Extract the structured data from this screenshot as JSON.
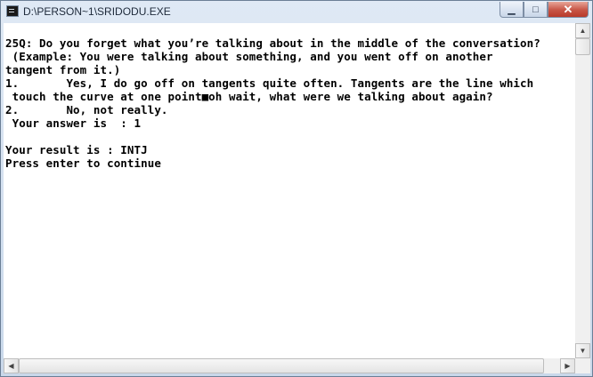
{
  "window": {
    "title": "D:\\PERSON~1\\SRIDODU.EXE",
    "icon": "console-app-icon",
    "minimize_glyph": "▁",
    "maximize_glyph": "□",
    "close_glyph": "✕"
  },
  "console": {
    "lines": [
      "25Q: Do you forget what you’re talking about in the middle of the conversation?",
      " (Example: You were talking about something, and you went off on another",
      "tangent from it.)",
      "1.       Yes, I do go off on tangents quite often. Tangents are the line which",
      " touch the curve at one point■oh wait, what were we talking about again?",
      "2.       No, not really.",
      " Your answer is  : 1",
      "",
      "Your result is : INTJ",
      "Press enter to continue"
    ]
  },
  "scrollbars": {
    "up_glyph": "▲",
    "down_glyph": "▼",
    "left_glyph": "◀",
    "right_glyph": "▶"
  },
  "colors": {
    "console_background": "#ffffff",
    "console_text": "#000000",
    "close_button": "#c75445"
  }
}
